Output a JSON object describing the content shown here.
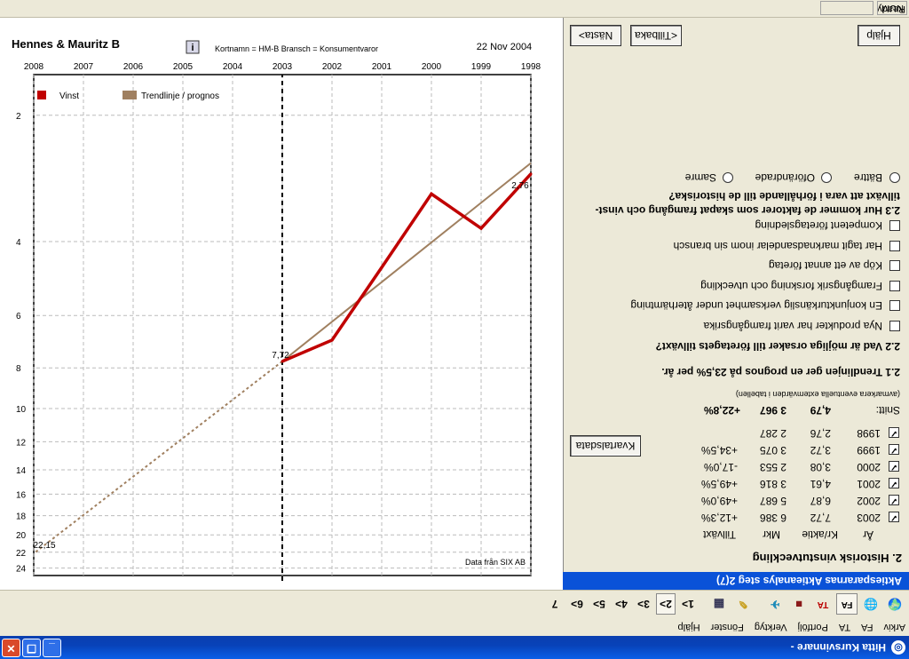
{
  "window": {
    "title": "Hitta Kursvinnare -"
  },
  "menu": [
    "Arkiv",
    "FA",
    "TA",
    "Portfölj",
    "Verktyg",
    "Fönster",
    "Hjälp"
  ],
  "toolbar": {
    "steps": [
      "1>",
      "2>",
      "3>",
      "4>",
      "5>",
      "6>",
      "7"
    ]
  },
  "panel": {
    "title": "Aktiespararnas Aktieanalys steg 2(7)",
    "heading": "2. Historisk vinstutveckling",
    "columns": [
      "År",
      "Kr/aktie",
      "Mkr",
      "Tillväxt"
    ],
    "rows": [
      {
        "year": "2003",
        "kr": "7,72",
        "mkr": "6 386",
        "growth": "+12,3%",
        "checked": true
      },
      {
        "year": "2002",
        "kr": "6,87",
        "mkr": "5 687",
        "growth": "+49,0%",
        "checked": true
      },
      {
        "year": "2001",
        "kr": "4,61",
        "mkr": "3 816",
        "growth": "+49,5%",
        "checked": true
      },
      {
        "year": "2000",
        "kr": "3,08",
        "mkr": "2 553",
        "growth": "-17,0%",
        "checked": true
      },
      {
        "year": "1999",
        "kr": "3,72",
        "mkr": "3 075",
        "growth": "+34,5%",
        "checked": true
      },
      {
        "year": "1998",
        "kr": "2,76",
        "mkr": "2 287",
        "growth": "",
        "checked": true
      }
    ],
    "snitt": {
      "label": "Snitt:",
      "kr": "4,79",
      "mkr": "3 967",
      "growth": "+22,8%"
    },
    "note": "(avmarkera eventuella extemvärden i tabellen)",
    "kvartalsdata_button": "Kvartalsdata",
    "q21": "2.1 Trendlinjen ger en prognos på 23,5% per år.",
    "q22": "2.2 Vad är möjliga orsaker till företagets tillväxt?",
    "causes": [
      "Nya produkter har varit framgångsrika",
      "En konjunkturkänslig verksamhet under återhämtning",
      "Framgångsrik forskning och utveckling",
      "Köp av ett annat företag",
      "Har tagit marknadsandelar inom sin bransch",
      "Kompetent företagsledning"
    ],
    "q23_line1": "2.3 Hur kommer de faktorer som skapat framgång och vinst-",
    "q23_line2": "tillväxt att vara i förhållande till de historiska?",
    "options": [
      "Bättre",
      "Oförändrade",
      "Samre"
    ],
    "help_button": "Hjälp",
    "back_button": "<Tillbaka",
    "next_button": "Nästa>"
  },
  "chart_data": {
    "type": "line",
    "title": "Hennes & Mauritz B",
    "x_ticks": [
      "1998",
      "1999",
      "2000",
      "2001",
      "2002",
      "2003",
      "2004",
      "2005",
      "2006",
      "2007",
      "2008"
    ],
    "y_ticks": [
      "2",
      "4",
      "6",
      "8",
      "10",
      "12",
      "14",
      "16",
      "18",
      "20",
      "22",
      "24"
    ],
    "yscale": "log",
    "ylim": [
      1.6,
      25
    ],
    "series": [
      {
        "name": "Vinst",
        "x": [
          1998,
          1999,
          2000,
          2001,
          2002,
          2003
        ],
        "y": [
          2.76,
          3.72,
          3.08,
          4.61,
          6.87,
          7.72
        ],
        "color": "#C00000"
      },
      {
        "name": "Trendlinje / prognos",
        "x": [
          1998,
          2003,
          2008
        ],
        "y": [
          2.6,
          7.72,
          22.15
        ],
        "color": "#A08060"
      }
    ],
    "labels": {
      "start": "2,76",
      "mid": "7,72",
      "end": "22,15"
    },
    "source": "Data från SIX AB",
    "date": "22 Nov 2004",
    "info": "Kortnamn = HM-B   Bransch = Konsumentvaror",
    "info_icon": "i"
  },
  "status": {
    "text": "Ready",
    "num": "NUM"
  }
}
